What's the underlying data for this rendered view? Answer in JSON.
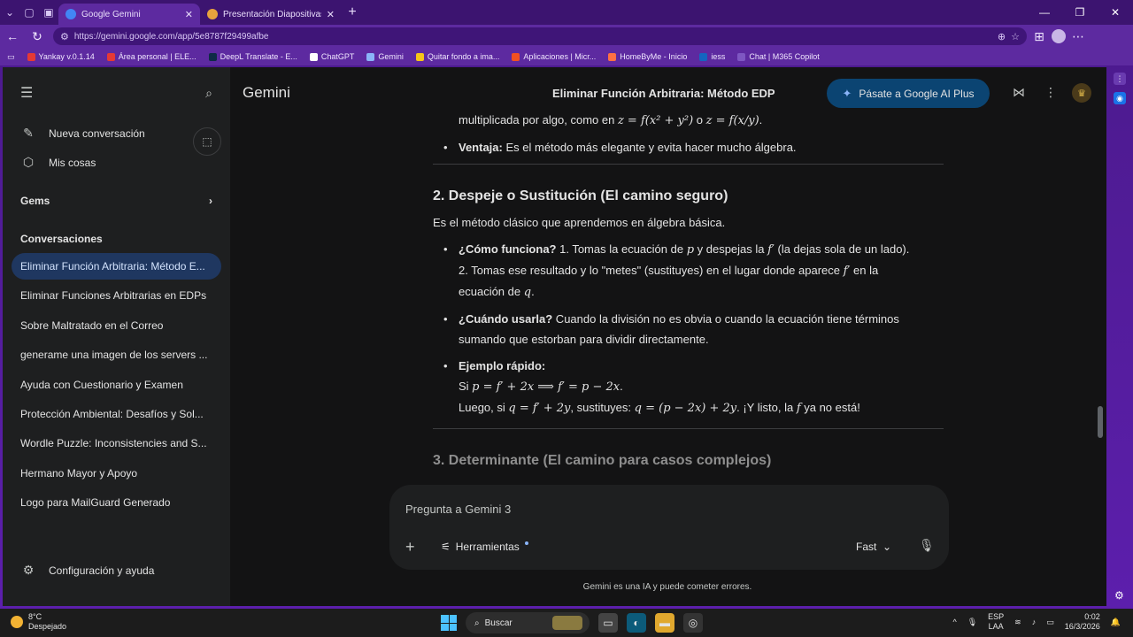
{
  "browser": {
    "tabs": [
      {
        "label": "Google Gemini",
        "active": true,
        "color": "#4285f4"
      },
      {
        "label": "Presentación Diapositivas Proyect",
        "active": false,
        "color": "#e8a33d"
      }
    ],
    "url": "https://gemini.google.com/app/5e8787f29499afbe",
    "bookmarks": [
      {
        "label": "Yankay v.0.1.14",
        "color": "#e53935"
      },
      {
        "label": "Área personal | ELE...",
        "color": "#e53935"
      },
      {
        "label": "DeepL Translate - E...",
        "color": "#0f2b46"
      },
      {
        "label": "ChatGPT",
        "color": "#ffffff"
      },
      {
        "label": "Gemini",
        "color": "#8ab4f8"
      },
      {
        "label": "Quitar fondo a ima...",
        "color": "#f5c518"
      },
      {
        "label": "Aplicaciones | Micr...",
        "color": "#f25022"
      },
      {
        "label": "HomeByMe - Inicio",
        "color": "#ff7043"
      },
      {
        "label": "iess",
        "color": "#1565c0"
      },
      {
        "label": "Chat | M365 Copilot",
        "color": "#7e57c2"
      }
    ]
  },
  "sidebar": {
    "new_chat": "Nueva conversación",
    "my_stuff": "Mis cosas",
    "gems": "Gems",
    "conversations_heading": "Conversaciones",
    "conversations": [
      {
        "label": "Eliminar Función Arbitraria: Método E...",
        "active": true
      },
      {
        "label": "Eliminar Funciones Arbitrarias en EDPs",
        "active": false
      },
      {
        "label": "Sobre Maltratado en el Correo",
        "active": false
      },
      {
        "label": "generame una imagen de los servers ...",
        "active": false
      },
      {
        "label": "Ayuda con Cuestionario y Examen",
        "active": false
      },
      {
        "label": "Protección Ambiental: Desafíos y Sol...",
        "active": false
      },
      {
        "label": "Wordle Puzzle: Inconsistencies and S...",
        "active": false
      },
      {
        "label": "Hermano Mayor y Apoyo",
        "active": false
      },
      {
        "label": "Logo para MailGuard Generado",
        "active": false
      }
    ],
    "settings": "Configuración y ayuda"
  },
  "header": {
    "brand": "Gemini",
    "title": "Eliminar Función Arbitraria: Método EDP",
    "upgrade_label": "Pásate a Google AI Plus"
  },
  "content": {
    "line1_prefix": "multiplicada por algo, como en ",
    "line1_math1": "z = f(x² + y²)",
    "line1_mid": " o ",
    "line1_math2": "z = f(x/y)",
    "line1_suffix": ".",
    "ventaja_label": "Ventaja:",
    "ventaja_text": " Es el método más elegante y evita hacer mucho álgebra.",
    "section2_title": "2. Despeje o Sustitución (El camino seguro)",
    "section2_intro": "Es el método clásico que aprendemos en álgebra básica.",
    "how_label": "¿Cómo funciona?",
    "how_text_a": " 1. Tomas la ecuación de ",
    "how_math_p": "p",
    "how_text_b": " y despejas la ",
    "how_math_f": "f′",
    "how_text_c": " (la dejas sola de un lado).",
    "how_text_d": "2. Tomas ese resultado y lo \"metes\" (sustituyes) en el lugar donde aparece ",
    "how_math_f2": "f′",
    "how_text_e": " en la",
    "how_text_f": "ecuación de ",
    "how_math_q": "q",
    "how_text_g": ".",
    "when_label": "¿Cuándo usarla?",
    "when_text": " Cuando la división no es obvia o cuando la ecuación tiene términos sumando que estorban para dividir directamente.",
    "example_label": "Ejemplo rápido:",
    "ex_line1_prefix": "Si ",
    "ex_line1_math": "p = f′ + 2x  ⟹  f′ = p − 2x",
    "ex_line1_suffix": ".",
    "ex_line2_prefix": "Luego, si ",
    "ex_line2_math1": "q = f′ + 2y",
    "ex_line2_mid": ", sustituyes: ",
    "ex_line2_math2": "q = (p − 2x) + 2y",
    "ex_line2_mid2": ". ¡Y listo, la ",
    "ex_line2_math3": "f",
    "ex_line2_suffix": " ya no está!",
    "section3_title": "3. Determinante (El camino para casos complejos)"
  },
  "composer": {
    "placeholder": "Pregunta a Gemini 3",
    "tools_label": "Herramientas",
    "mode": "Fast"
  },
  "disclaimer": "Gemini es una IA y puede cometer errores.",
  "taskbar": {
    "temperature": "8°C",
    "weather": "Despejado",
    "search": "Buscar",
    "lang_top": "ESP",
    "lang_bottom": "LAA",
    "time": "0:02",
    "date": "16/3/2026"
  }
}
